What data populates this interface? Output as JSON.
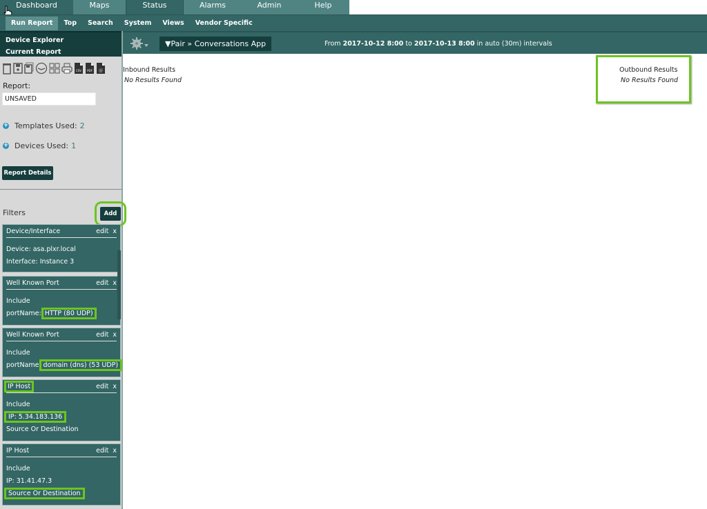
{
  "top_nav": {
    "tabs": [
      {
        "label": "Dashboard",
        "active": false
      },
      {
        "label": "Maps",
        "active": false
      },
      {
        "label": "Status",
        "active": true
      },
      {
        "label": "Alarms",
        "active": false
      },
      {
        "label": "Admin",
        "active": false
      },
      {
        "label": "Help",
        "active": false
      }
    ]
  },
  "sub_nav": {
    "items": [
      {
        "label": "Run Report",
        "active": true
      },
      {
        "label": "Top",
        "active": false
      },
      {
        "label": "Search",
        "active": false
      },
      {
        "label": "System",
        "active": false
      },
      {
        "label": "Views",
        "active": false
      },
      {
        "label": "Vendor Specific",
        "active": false
      }
    ]
  },
  "sidebar": {
    "menu": [
      "Device Explorer",
      "Current Report"
    ],
    "toolbar_icons": [
      "trash-icon",
      "save-icon",
      "save-as-icon",
      "clock-icon",
      "grid-icon",
      "print-icon",
      "csv-icon",
      "pdf-icon",
      "email-icon"
    ],
    "toolbar_icon_text": {
      "csv": "CSV",
      "pdf": "PDF",
      "email": "@"
    },
    "report_label": "Report:",
    "report_value": "UNSAVED",
    "templates_used_label": "Templates Used:",
    "templates_used_count": "2",
    "devices_used_label": "Devices Used:",
    "devices_used_count": "1",
    "report_details_button": "Report Details",
    "filters_label": "Filters",
    "add_button": "Add",
    "edit_label": "edit",
    "remove_label": "x",
    "filters": [
      {
        "title": "Device/Interface",
        "lines": [
          "Device: asa.plxr.local",
          "Interface: Instance 3"
        ]
      },
      {
        "title": "Well Known Port",
        "lines": [
          "Include",
          "portName: HTTP (80 UDP)"
        ],
        "key": "portName:",
        "value": "HTTP (80 UDP)"
      },
      {
        "title": "Well Known Port",
        "lines": [
          "Include",
          "portName domain (dns) (53 UDP)"
        ],
        "key": "portName",
        "value": "domain (dns) (53 UDP)"
      },
      {
        "title": "IP Host",
        "lines": [
          "Include",
          "IP: 5.34.183.136",
          "Source Or Destination"
        ]
      },
      {
        "title": "IP Host",
        "lines": [
          "Include",
          "IP: 31.41.47.3",
          "Source Or Destination"
        ]
      }
    ]
  },
  "main": {
    "breadcrumb": "▼Pair » Conversations App",
    "range": {
      "from_label": "From",
      "from": "2017-10-12 8:00",
      "to_label": "to",
      "to": "2017-10-13 8:00",
      "interval_text": "in auto (30m) intervals"
    },
    "inbound_title": "Inbound Results",
    "inbound_empty": "No Results Found",
    "outbound_title": "Outbound Results",
    "outbound_empty": "No Results Found"
  },
  "colors": {
    "nav_teal": "#4f8482",
    "dark_teal": "#336664",
    "darkest_teal": "#153e3d",
    "highlight_green": "#6cc51f"
  }
}
